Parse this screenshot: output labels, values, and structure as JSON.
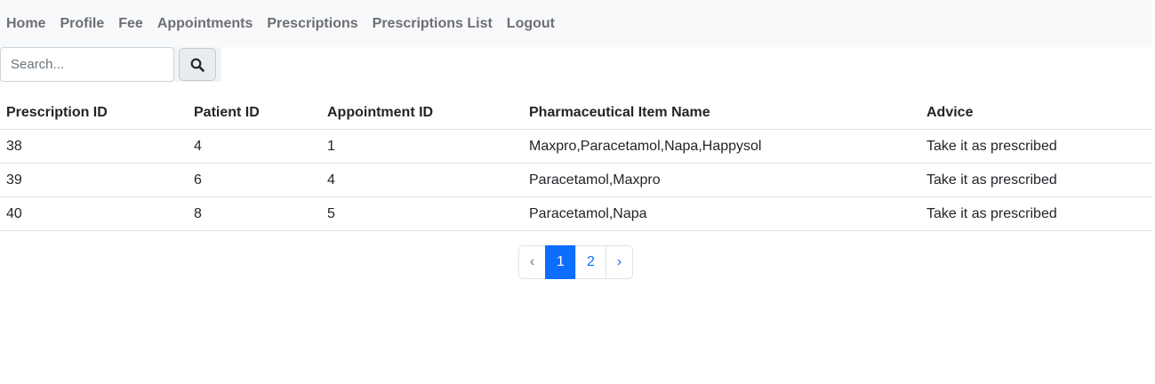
{
  "nav": {
    "items": [
      {
        "label": "Home"
      },
      {
        "label": "Profile"
      },
      {
        "label": "Fee"
      },
      {
        "label": "Appointments"
      },
      {
        "label": "Prescriptions"
      },
      {
        "label": "Prescriptions List"
      },
      {
        "label": "Logout"
      }
    ]
  },
  "search": {
    "placeholder": "Search...",
    "value": "",
    "button_icon": "search-icon"
  },
  "table": {
    "headers": [
      "Prescription ID",
      "Patient ID",
      "Appointment ID",
      "Pharmaceutical Item Name",
      "Advice"
    ],
    "rows": [
      [
        "38",
        "4",
        "1",
        "Maxpro,Paracetamol,Napa,Happysol",
        "Take it as prescribed"
      ],
      [
        "39",
        "6",
        "4",
        "Paracetamol,Maxpro",
        "Take it as prescribed"
      ],
      [
        "40",
        "8",
        "5",
        "Paracetamol,Napa",
        "Take it as prescribed"
      ]
    ]
  },
  "pagination": {
    "prev": "‹",
    "pages": [
      "1",
      "2"
    ],
    "active_page": "1",
    "next": "›"
  },
  "colors": {
    "navbar_bg": "#f8f9fa",
    "nav_text": "#6c6f73",
    "accent": "#0d6efd",
    "border": "#dee2e6"
  }
}
